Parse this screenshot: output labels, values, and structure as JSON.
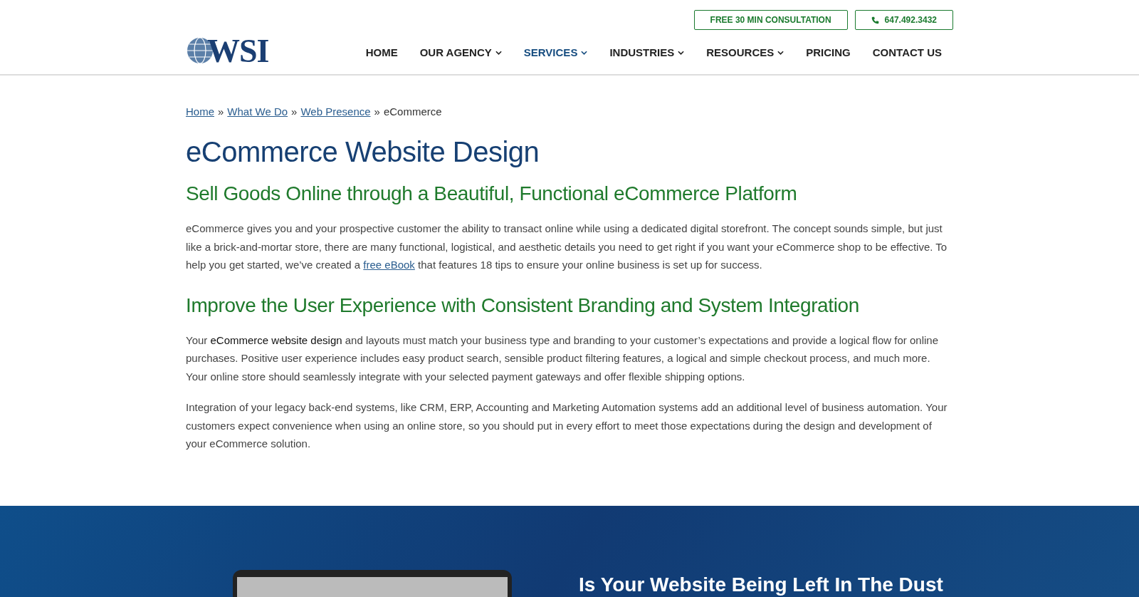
{
  "header": {
    "logo": "WSI",
    "cta_button": "FREE 30 MIN CONSULTATION",
    "phone_button": "647.492.3432",
    "nav": [
      {
        "label": "HOME",
        "dropdown": false,
        "selected": false
      },
      {
        "label": "OUR AGENCY",
        "dropdown": true,
        "selected": false
      },
      {
        "label": "SERVICES",
        "dropdown": true,
        "selected": true
      },
      {
        "label": "INDUSTRIES",
        "dropdown": true,
        "selected": false
      },
      {
        "label": "RESOURCES",
        "dropdown": true,
        "selected": false
      },
      {
        "label": "PRICING",
        "dropdown": false,
        "selected": false
      },
      {
        "label": "CONTACT US",
        "dropdown": false,
        "selected": false
      }
    ]
  },
  "breadcrumb": {
    "links": [
      "Home",
      "What We Do",
      "Web Presence"
    ],
    "separator": "»",
    "current": "eCommerce"
  },
  "title": "eCommerce Website Design",
  "sections": [
    {
      "heading": "Sell Goods Online through a Beautiful, Functional eCommerce Platform",
      "paragraphs": [
        [
          {
            "kind": "text",
            "text": "eCommerce gives you and your prospective customer the ability to transact online while using a dedicated digital storefront. The concept sounds simple, but just like a brick-and-mortar store, there are many functional, logistical, and aesthetic details you need to get right if you want your eCommerce shop to be effective. To help you get started, we’ve created a "
          },
          {
            "kind": "link",
            "text": "free eBook"
          },
          {
            "kind": "text",
            "text": " that features 18 tips to ensure your online business is set up for success."
          }
        ]
      ]
    },
    {
      "heading": "Improve the User Experience with Consistent Branding and System Integration",
      "paragraphs": [
        [
          {
            "kind": "text",
            "text": "Your "
          },
          {
            "kind": "strong",
            "text": "eCommerce website design"
          },
          {
            "kind": "text",
            "text": " and layouts must match your business type and branding to your customer’s expectations and provide a logical flow for online purchases. Positive user experience includes easy product search, sensible product filtering features, a logical and simple checkout process, and much more. Your online store should seamlessly integrate with your selected payment gateways and offer flexible shipping options."
          }
        ],
        [
          {
            "kind": "text",
            "text": "Integration of your legacy back-end systems, like CRM, ERP, Accounting and Marketing Automation systems add an additional level of business automation. Your customers expect convenience when using an online store, so you should put in every effort to meet those expectations during the design and development of your eCommerce solution."
          }
        ]
      ]
    }
  ],
  "banner": {
    "heading": "Is Your Website Being Left In The Dust"
  }
}
